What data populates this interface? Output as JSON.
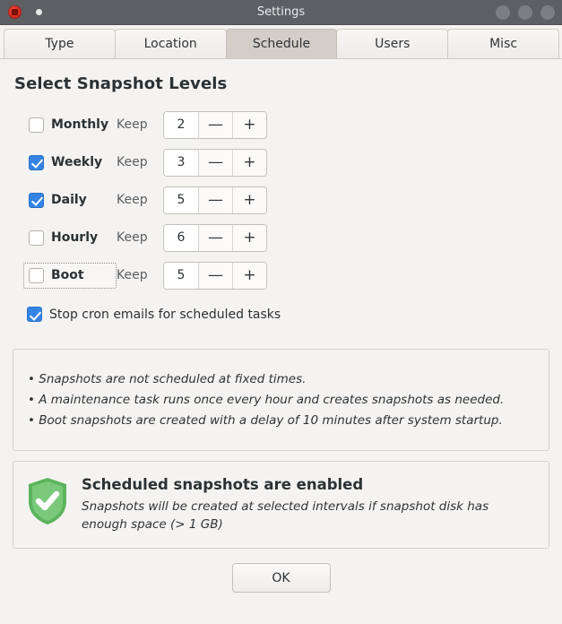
{
  "window": {
    "title": "Settings",
    "app_icon": "app-icon",
    "controls": [
      "minimize-button",
      "maximize-button",
      "close-button"
    ]
  },
  "tabs": [
    {
      "label": "Type",
      "active": false
    },
    {
      "label": "Location",
      "active": false
    },
    {
      "label": "Schedule",
      "active": true
    },
    {
      "label": "Users",
      "active": false
    },
    {
      "label": "Misc",
      "active": false
    }
  ],
  "main": {
    "heading": "Select Snapshot Levels",
    "keep_label": "Keep",
    "minus_glyph": "—",
    "plus_glyph": "+",
    "levels": [
      {
        "label": "Monthly",
        "checked": false,
        "keep": "2",
        "focused": false
      },
      {
        "label": "Weekly",
        "checked": true,
        "keep": "3",
        "focused": false
      },
      {
        "label": "Daily",
        "checked": true,
        "keep": "5",
        "focused": false
      },
      {
        "label": "Hourly",
        "checked": false,
        "keep": "6",
        "focused": false
      },
      {
        "label": "Boot",
        "checked": false,
        "keep": "5",
        "focused": true
      }
    ],
    "cron": {
      "label": "Stop cron emails for scheduled tasks",
      "checked": true
    },
    "notes": [
      "• Snapshots are not scheduled at fixed times.",
      "• A maintenance task runs once every hour and creates snapshots as needed.",
      "• Boot snapshots are created with a delay of 10 minutes after system startup."
    ],
    "status": {
      "icon": "shield-check-icon",
      "title": "Scheduled snapshots are enabled",
      "description": "Snapshots will be created at selected intervals if snapshot disk has enough space (> 1 GB)"
    }
  },
  "footer": {
    "ok_label": "OK"
  },
  "colors": {
    "accent_checkbox": "#3584e4",
    "status_shield": "#6ec16e",
    "titlebar": "#5d5f63",
    "active_tab": "#d3cec8",
    "background": "#f4f3f1"
  }
}
